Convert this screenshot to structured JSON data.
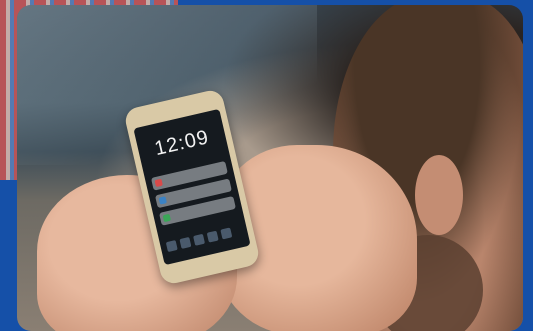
{
  "phone": {
    "time": "12:09",
    "notifications": [
      {
        "icon": "mail-icon",
        "color": "#d84a4a"
      },
      {
        "icon": "message-icon",
        "color": "#3b82c4"
      },
      {
        "icon": "phone-icon",
        "color": "#3aa657"
      }
    ]
  },
  "colors": {
    "background": "#1550a8"
  }
}
